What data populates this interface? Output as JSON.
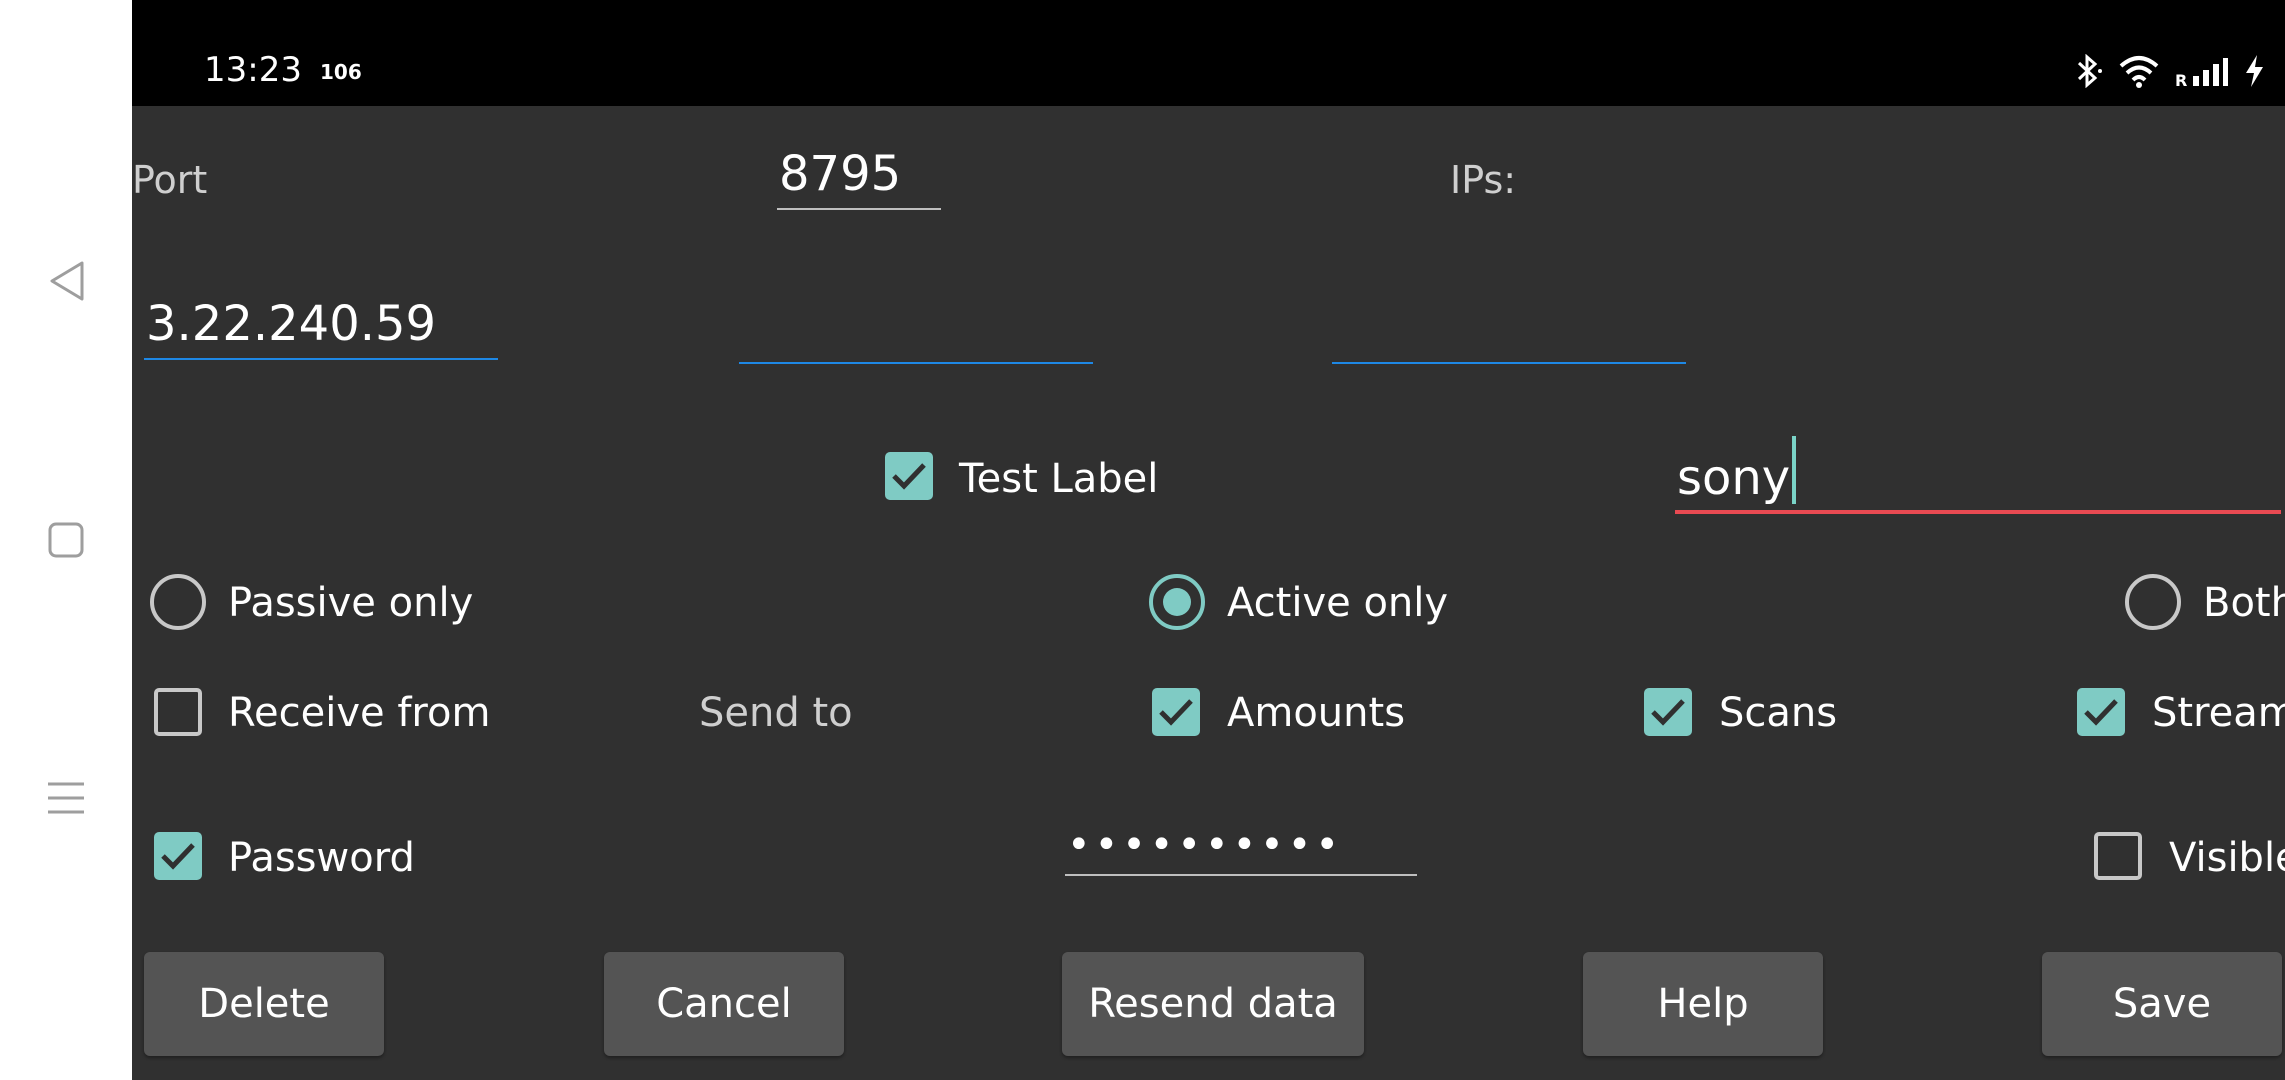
{
  "status_bar": {
    "time": "13:23",
    "extra": "106"
  },
  "form": {
    "port_label": "Port",
    "port_value": "8795",
    "ips_label": "IPs:",
    "ip_fields": [
      "3.22.240.59",
      "",
      ""
    ],
    "test_label": "Test Label",
    "test_label_checked": true,
    "name_value": "sony",
    "modes": [
      {
        "label": "Passive only",
        "selected": false
      },
      {
        "label": "Active only",
        "selected": true
      },
      {
        "label": "Both",
        "selected": false
      }
    ],
    "receive_from": {
      "label": "Receive from",
      "checked": false
    },
    "send_to_label": "Send to",
    "amounts": {
      "label": "Amounts",
      "checked": true
    },
    "scans": {
      "label": "Scans",
      "checked": true
    },
    "streams": {
      "label": "Streams",
      "checked": true
    },
    "password": {
      "label": "Password",
      "checked": true,
      "value": "••••••••••"
    },
    "visible": {
      "label": "Visible",
      "checked": false
    }
  },
  "buttons": {
    "delete": "Delete",
    "cancel": "Cancel",
    "resend": "Resend data",
    "help": "Help",
    "save": "Save"
  },
  "colors": {
    "accent": "#7fcbc4",
    "field_line": "#1e88e5",
    "error_line": "#e84a52",
    "background": "#303030"
  },
  "icons": [
    "back-icon",
    "home-icon",
    "recents-icon",
    "bluetooth-icon",
    "wifi-icon",
    "signal-icon",
    "charging-icon",
    "check-icon"
  ]
}
